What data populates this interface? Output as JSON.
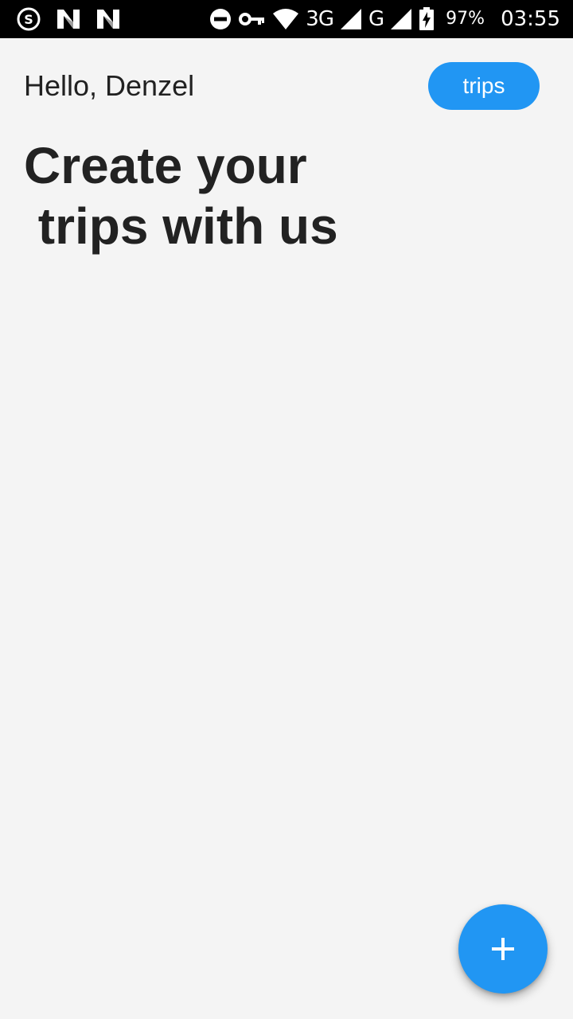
{
  "status_bar": {
    "left_icons": [
      "s-icon",
      "n-icon",
      "n-icon"
    ],
    "right_icons": [
      "do-not-disturb-icon",
      "vpn-key-icon",
      "wifi-icon",
      "signal-icon",
      "signal-icon",
      "battery-charging-icon"
    ],
    "network_label_1": "3G",
    "network_label_2": "G",
    "battery_percent": "97%",
    "time": "03:55"
  },
  "header": {
    "greeting": "Hello, Denzel",
    "trips_button_label": "trips"
  },
  "main": {
    "headline": "Create your\n trips with us"
  },
  "fab": {
    "icon": "plus-icon"
  },
  "colors": {
    "accent": "#2196f3",
    "background": "#f4f4f4",
    "text": "#212121",
    "status_bar": "#000000"
  }
}
